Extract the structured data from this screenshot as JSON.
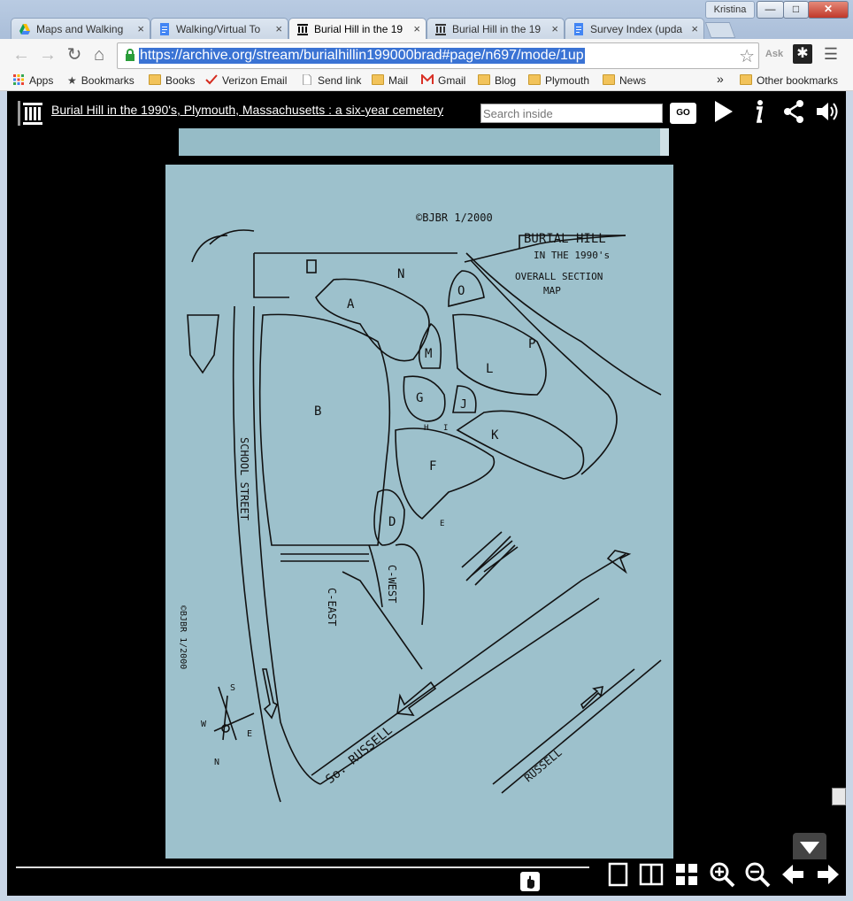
{
  "window": {
    "user": "Kristina",
    "minimize": "—",
    "maximize": "□",
    "close": "✕"
  },
  "tabs": [
    {
      "label": "Maps and Walking",
      "icon": "google-drive-icon",
      "active": false
    },
    {
      "label": "Walking/Virtual To",
      "icon": "google-docs-icon",
      "active": false
    },
    {
      "label": "Burial Hill in the 19",
      "icon": "internet-archive-icon",
      "active": true
    },
    {
      "label": "Burial Hill in the 19",
      "icon": "internet-archive-icon",
      "active": false
    },
    {
      "label": "Survey Index (upda",
      "icon": "google-docs-icon",
      "active": false
    }
  ],
  "tab_close": "×",
  "address_bar": {
    "url": "https://archive.org/stream/burialhillin199000brad#page/n697/mode/1up"
  },
  "bookmarks": [
    {
      "label": "Apps",
      "icon": "apps-grid-icon"
    },
    {
      "label": "Bookmarks",
      "icon": "star-icon"
    },
    {
      "label": "Books",
      "icon": "folder-icon"
    },
    {
      "label": "Verizon Email",
      "icon": "verizon-icon"
    },
    {
      "label": "Send link",
      "icon": "page-icon"
    },
    {
      "label": "Mail",
      "icon": "folder-icon"
    },
    {
      "label": "Gmail",
      "icon": "gmail-icon"
    },
    {
      "label": "Blog",
      "icon": "folder-icon"
    },
    {
      "label": "Plymouth",
      "icon": "folder-icon"
    },
    {
      "label": "News",
      "icon": "folder-icon"
    }
  ],
  "bookmarks_overflow": "»",
  "other_bookmarks": "Other bookmarks",
  "viewer": {
    "title": "Burial Hill in the 1990's, Plymouth, Massachusetts : a six-year cemetery",
    "search_placeholder": "Search inside",
    "go_label": "GO"
  },
  "map": {
    "copyright_top": "©BJBR 1/2000",
    "title_lines": [
      "BURIAL HILL",
      "IN THE 1990's",
      "OVERALL SECTION",
      "MAP"
    ],
    "copyright_side": "©BJBR 1/2000",
    "school_street": "SCHOOL STREET",
    "so_russell": "So. RUSSELL",
    "russell": "RUSSELL",
    "sections": {
      "N": "N",
      "O": "O",
      "A": "A",
      "P": "P",
      "M": "M",
      "L": "L",
      "G": "G",
      "J": "J",
      "H": "H",
      "I": "I",
      "B": "B",
      "K": "K",
      "F": "F",
      "D": "D",
      "E": "E",
      "C_EAST": "C-EAST",
      "C_WEST": "C-WEST"
    },
    "compass": {
      "s": "S",
      "w": "W",
      "n": "N",
      "e": "E"
    }
  }
}
